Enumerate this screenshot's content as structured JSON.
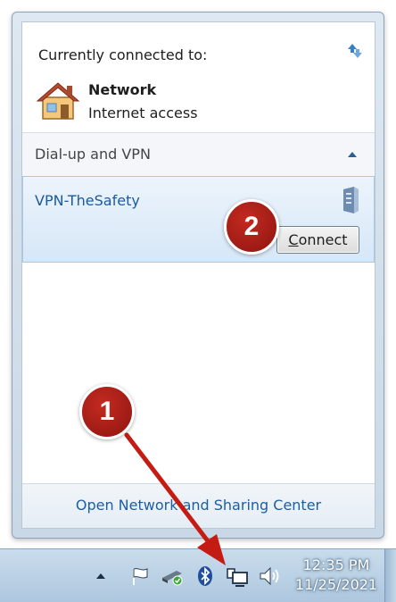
{
  "flyout": {
    "connected_title": "Currently connected to:",
    "network": {
      "name": "Network",
      "status": "Internet access"
    },
    "dialup_section": {
      "title": "Dial-up and VPN"
    },
    "vpn": {
      "name": "VPN-TheSafety",
      "connect_label_underlined": "C",
      "connect_label_rest": "onnect"
    },
    "footer_link": "Open Network and Sharing Center"
  },
  "taskbar": {
    "time": "12:35 PM",
    "date": "11/25/2021",
    "tray_icons": [
      "show-hidden-icons-arrow",
      "action-center-flag-icon",
      "usb-device-icon",
      "bluetooth-icon",
      "network-icon",
      "volume-icon"
    ]
  },
  "annotations": {
    "step_1": "1",
    "step_2": "2"
  },
  "colors": {
    "link": "#1c5fa5",
    "badge": "#a01c16",
    "taskbar": "#b9d0e4"
  }
}
